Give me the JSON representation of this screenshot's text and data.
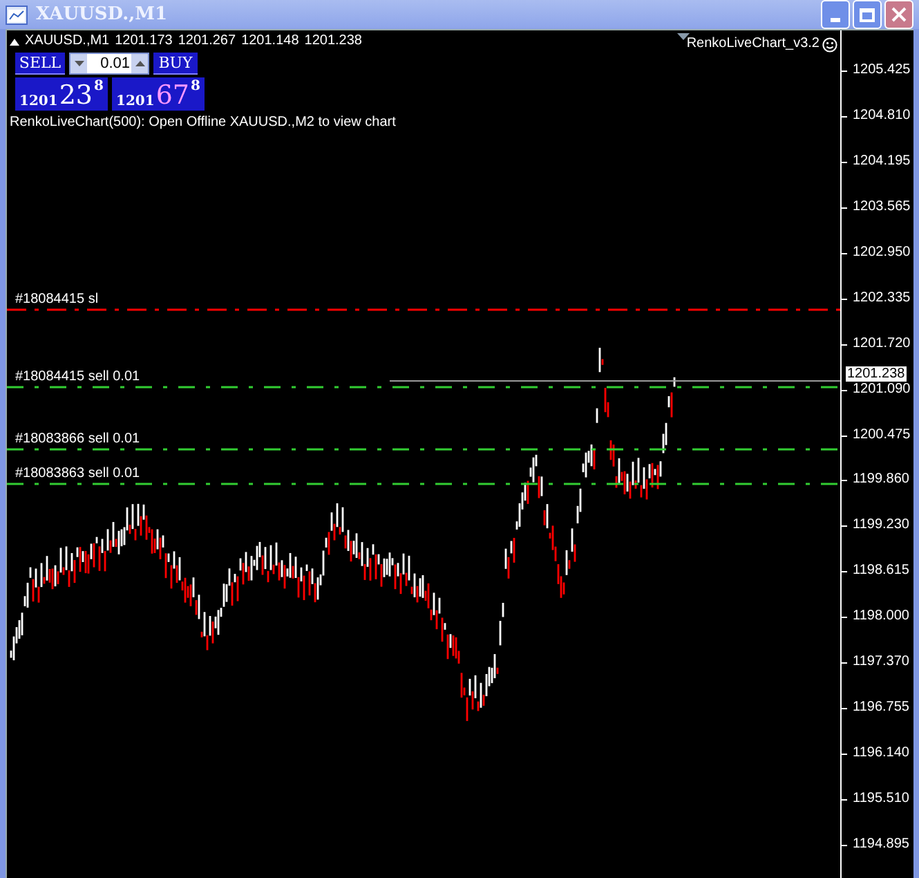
{
  "window": {
    "title": "XAUUSD.,M1"
  },
  "chart_header": {
    "symbol": "XAUUSD.,M1",
    "prices": [
      "1201.173",
      "1201.267",
      "1201.148",
      "1201.238"
    ]
  },
  "trade_panel": {
    "sell_button": "SELL",
    "lot": "0.01",
    "buy_button": "BUY",
    "bid": {
      "big": "1201",
      "pips": "23",
      "point": "8"
    },
    "ask": {
      "big": "1201",
      "pips": "67",
      "point": "8"
    }
  },
  "indicator_message": "RenkoLiveChart(500): Open Offline XAUUSD.,M2 to view chart",
  "expert": {
    "name": "RenkoLiveChart_v3.2"
  },
  "order_lines": [
    {
      "label": "#18084415 sl",
      "kind": "sl",
      "color": "#ff0000"
    },
    {
      "label": "#18084415 sell 0.01",
      "kind": "order",
      "color": "#32cd32"
    },
    {
      "label": "#18083866 sell 0.01",
      "kind": "order",
      "color": "#32cd32"
    },
    {
      "label": "#18083863 sell 0.01",
      "kind": "order",
      "color": "#32cd32"
    }
  ],
  "price_axis": {
    "current_price": "1201.238",
    "ticks": [
      "1205.425",
      "1204.810",
      "1204.195",
      "1203.565",
      "1202.950",
      "1202.335",
      "1201.720",
      "1201.090",
      "1200.475",
      "1199.860",
      "1199.230",
      "1198.615",
      "1198.000",
      "1197.370",
      "1196.755",
      "1196.140",
      "1195.510",
      "1194.895"
    ]
  }
}
